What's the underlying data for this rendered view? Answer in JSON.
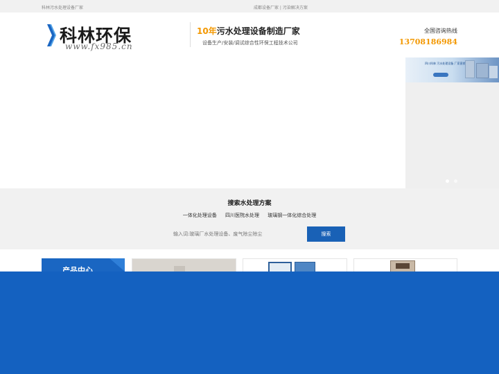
{
  "topbar": {
    "left_text": "科林污水处理设备厂家",
    "right_text": "成都设备厂家 | 污染解决方案"
  },
  "header": {
    "logo_name": "科林环保",
    "logo_url": "www.fx985.cn",
    "slogan_accent": "10年",
    "slogan_main": "污水处理设备制造厂家",
    "slogan_sub": "设备生产/安装/调试综合性环保工程技术公司",
    "hotline_label": "全国咨询热线",
    "hotline_number": "13708186984"
  },
  "banner": {
    "thumbnail_text": "四川科林 污水处理设备 厂家直销"
  },
  "search": {
    "title": "搜索水处理方案",
    "hot_links": [
      "一体化处理设备",
      "四川医院水处理",
      "玻璃钢一体化综合处理"
    ],
    "placeholder": "输入词:玻璃厂水处理设备、废气除尘除尘",
    "button_label": "搜索"
  },
  "products": {
    "center_label": "产品中心"
  },
  "colors": {
    "accent_orange": "#f39800",
    "brand_blue": "#1961b6",
    "footer_blue": "#1461c0"
  }
}
